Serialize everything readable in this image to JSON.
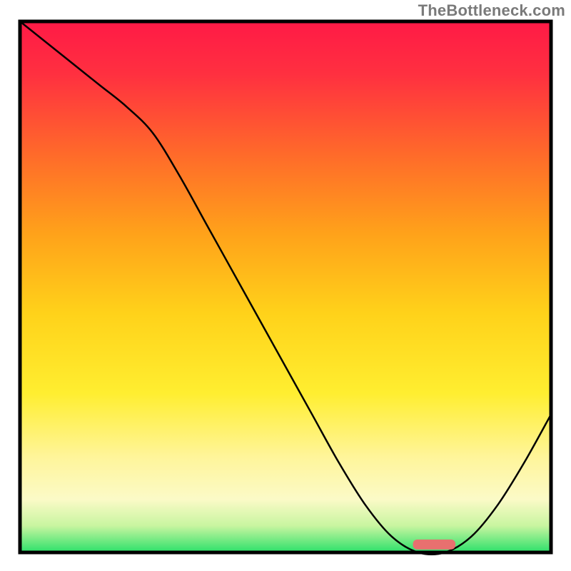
{
  "watermark": "TheBottleneck.com",
  "chart_data": {
    "type": "line",
    "title": "",
    "xlabel": "",
    "ylabel": "",
    "xlim": [
      0,
      100
    ],
    "ylim": [
      0,
      100
    ],
    "x": [
      0,
      5,
      10,
      15,
      20,
      25,
      30,
      35,
      40,
      45,
      50,
      55,
      60,
      65,
      70,
      75,
      80,
      85,
      90,
      95,
      100
    ],
    "values": [
      100,
      96,
      92,
      88,
      84,
      79,
      71,
      62,
      53,
      44,
      35,
      26,
      17,
      9,
      3,
      0,
      0,
      3,
      9,
      17,
      26
    ],
    "marker": {
      "x_start": 74,
      "x_end": 82,
      "y": 1.5
    },
    "background_gradient": {
      "stops": [
        {
          "offset": 0.0,
          "color": "#ff1a46"
        },
        {
          "offset": 0.1,
          "color": "#ff3040"
        },
        {
          "offset": 0.25,
          "color": "#ff6a2a"
        },
        {
          "offset": 0.4,
          "color": "#ffa21a"
        },
        {
          "offset": 0.55,
          "color": "#ffd21a"
        },
        {
          "offset": 0.7,
          "color": "#ffee30"
        },
        {
          "offset": 0.82,
          "color": "#fff59a"
        },
        {
          "offset": 0.9,
          "color": "#fbfac7"
        },
        {
          "offset": 0.95,
          "color": "#c8f5a0"
        },
        {
          "offset": 1.0,
          "color": "#2be06a"
        }
      ]
    },
    "border_color": "#000000",
    "curve_color": "#000000",
    "marker_color": "#e8706f"
  },
  "plot_geometry": {
    "outer_w": 800,
    "outer_h": 800,
    "inner_x": 28,
    "inner_y": 30,
    "inner_w": 744,
    "inner_h": 744,
    "border_width": 5,
    "curve_width": 2.5,
    "marker_rx": 6,
    "marker_height": 14
  }
}
